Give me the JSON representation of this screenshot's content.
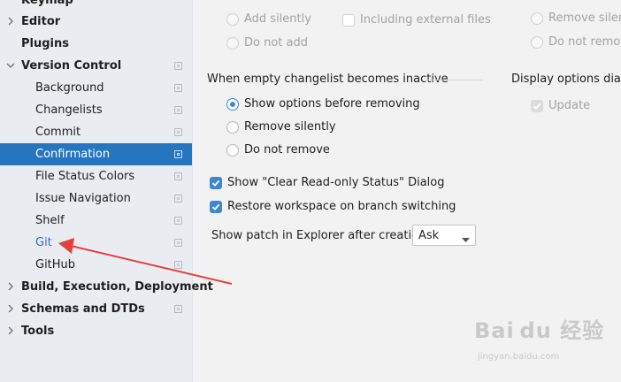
{
  "sidebar": {
    "items": [
      {
        "label": "Keymap"
      },
      {
        "label": "Editor"
      },
      {
        "label": "Plugins"
      },
      {
        "label": "Version Control"
      },
      {
        "label": "Background"
      },
      {
        "label": "Changelists"
      },
      {
        "label": "Commit"
      },
      {
        "label": "Confirmation"
      },
      {
        "label": "File Status Colors"
      },
      {
        "label": "Issue Navigation"
      },
      {
        "label": "Shelf"
      },
      {
        "label": "Git"
      },
      {
        "label": "GitHub"
      },
      {
        "label": "Build, Execution, Deployment"
      },
      {
        "label": "Schemas and DTDs"
      },
      {
        "label": "Tools"
      }
    ],
    "selected": "Confirmation"
  },
  "top_options": {
    "add_silently": "Add silently",
    "do_not_add": "Do not add",
    "including_external_files": "Including external files",
    "remove_silently": "Remove silent",
    "do_not_remove": "Do not remov"
  },
  "empty_changelist": {
    "title": "When empty changelist becomes inactive",
    "options": [
      {
        "label": "Show options before removing",
        "checked": true
      },
      {
        "label": "Remove silently",
        "checked": false
      },
      {
        "label": "Do not remove",
        "checked": false
      }
    ]
  },
  "display_options": {
    "title": "Display options dialo",
    "update_label": "Update",
    "update_checked": true
  },
  "checkboxes": {
    "clear_readonly": "Show \"Clear Read-only Status\" Dialog",
    "restore_workspace": "Restore workspace on branch switching"
  },
  "patch": {
    "label": "Show patch in Explorer after creation:",
    "value": "Ask"
  },
  "watermark": {
    "brand": "Bai du 经验",
    "url": "jingyan.baidu.com"
  },
  "colors": {
    "selection": "#2675bf",
    "accent": "#3d87d6",
    "annotation_arrow": "#e5403b"
  }
}
